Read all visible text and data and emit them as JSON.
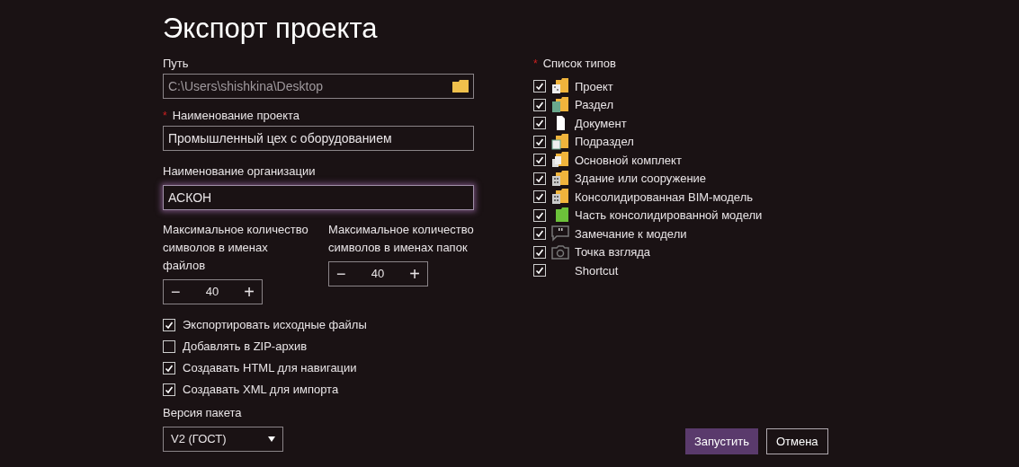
{
  "title": "Экспорт проекта",
  "path": {
    "label": "Путь",
    "value": "C:\\Users\\shishkina\\Desktop"
  },
  "project_name": {
    "label": "Наименование проекта",
    "required_mark": "*",
    "value": "Промышленный цех с оборудованием"
  },
  "organization": {
    "label": "Наименование организации",
    "value": "АСКОН",
    "focused": true
  },
  "counters": [
    {
      "label": "Максимальное количество символов в именах файлов",
      "value": "40",
      "minus": "−",
      "plus": "+"
    },
    {
      "label": "Максимальное количество символов в именах папок",
      "value": "40",
      "minus": "−",
      "plus": "+"
    }
  ],
  "options": [
    {
      "label": "Экспортировать исходные файлы",
      "checked": true
    },
    {
      "label": "Добавлять в ZIP-архив",
      "checked": false
    },
    {
      "label": "Создавать HTML для навигации",
      "checked": true
    },
    {
      "label": "Создавать XML для импорта",
      "checked": true
    }
  ],
  "package_version": {
    "label": "Версия пакета",
    "value": "V2 (ГОСТ)"
  },
  "types": {
    "label": "Список типов",
    "required_mark": "*",
    "items": [
      {
        "label": "Проект",
        "checked": true,
        "kind": "project"
      },
      {
        "label": "Раздел",
        "checked": true,
        "kind": "section"
      },
      {
        "label": "Документ",
        "checked": true,
        "kind": "document"
      },
      {
        "label": "Подраздел",
        "checked": true,
        "kind": "subsection"
      },
      {
        "label": "Основной комплект",
        "checked": true,
        "kind": "set"
      },
      {
        "label": "Здание или сооружение",
        "checked": true,
        "kind": "building"
      },
      {
        "label": "Консолидированная BIM-модель",
        "checked": true,
        "kind": "building"
      },
      {
        "label": "Часть консолидированной модели",
        "checked": true,
        "kind": "part"
      },
      {
        "label": "Замечание к модели",
        "checked": true,
        "kind": "comment"
      },
      {
        "label": "Точка взгляда",
        "checked": true,
        "kind": "viewpoint"
      },
      {
        "label": "Shortcut",
        "checked": true,
        "kind": "none"
      }
    ]
  },
  "buttons": [
    {
      "label": "Запустить",
      "kind": "primary"
    },
    {
      "label": "Отмена",
      "kind": "secondary"
    }
  ]
}
